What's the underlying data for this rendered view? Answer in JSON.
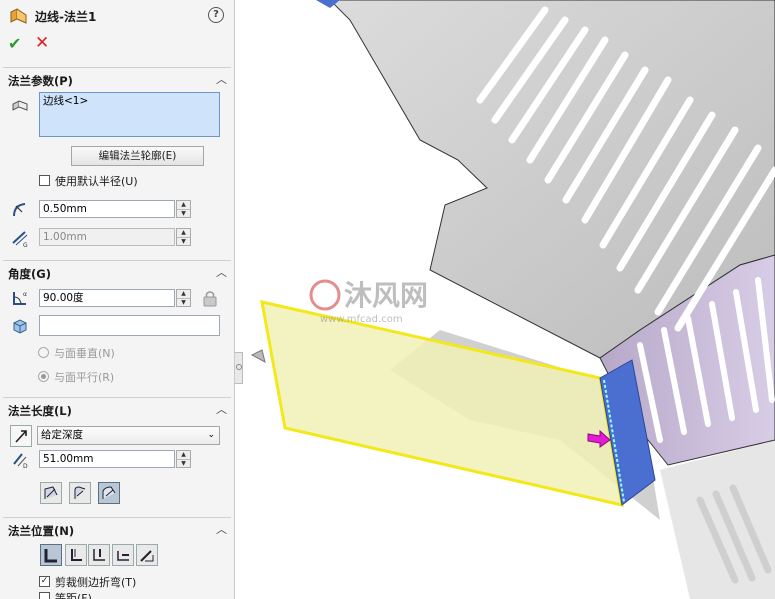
{
  "feature": {
    "title": "边线-法兰1",
    "help_icon": "question-icon"
  },
  "actions": {
    "ok_label": "✔",
    "cancel_label": "✕"
  },
  "flange_params": {
    "section_label": "法兰参数(P)",
    "edge_list_value": "边线<1>",
    "edit_profile_button": "编辑法兰轮廓(E)",
    "use_default_radius_label": "使用默认半径(U)",
    "use_default_radius_checked": false,
    "bend_radius_value": "0.50mm",
    "gap_value": "1.00mm"
  },
  "angle": {
    "section_label": "角度(G)",
    "angle_value": "90.00度",
    "face_selection_value": "",
    "perpendicular_label": "与面垂直(N)",
    "parallel_label": "与面平行(R)",
    "parallel_selected": true
  },
  "flange_length": {
    "section_label": "法兰长度(L)",
    "end_condition": "给定深度",
    "length_value": "51.00mm"
  },
  "flange_position": {
    "section_label": "法兰位置(N)",
    "trim_side_bends_label": "剪裁侧边折弯(T)",
    "trim_side_bends_checked": true,
    "offset_label": "等距(F)",
    "offset_checked": false
  },
  "watermark": {
    "text": "沐风网",
    "url": "www.mfcad.com"
  },
  "colors": {
    "accent": "#2e9a2e",
    "cancel": "#dd2222",
    "flange_preview": "#f1f1b6",
    "selected_edge": "#4a6fd1"
  }
}
